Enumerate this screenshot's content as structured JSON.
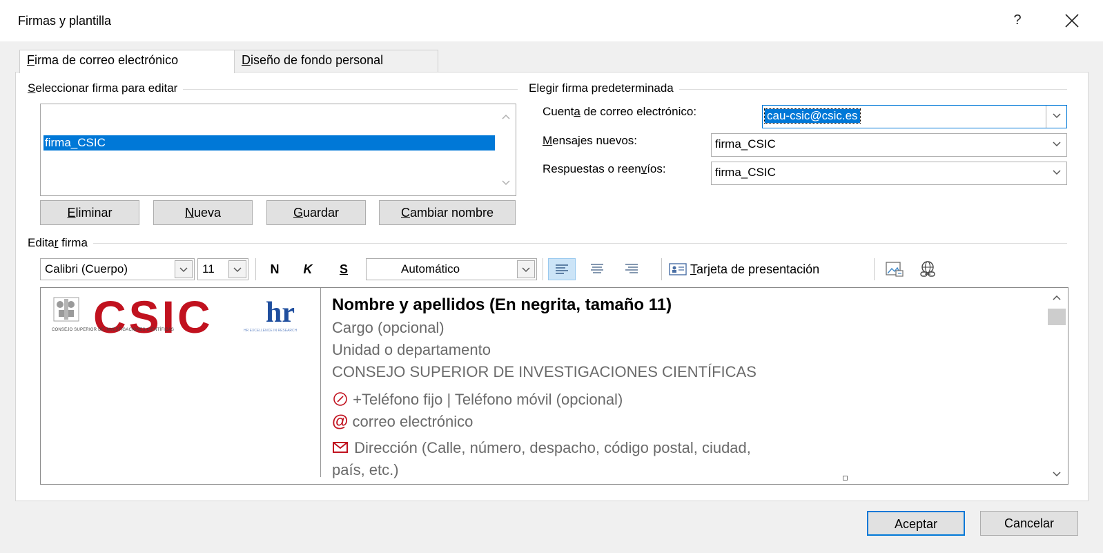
{
  "window": {
    "title": "Firmas y plantilla",
    "help": "?"
  },
  "tabs": [
    {
      "label": "Firma de correo electrónico",
      "accel": "F",
      "rest": "irma de correo electrónico"
    },
    {
      "label": "Diseño de fondo personal",
      "accel": "D",
      "rest": "iseño de fondo personal"
    }
  ],
  "select_sig": {
    "title_accel": "S",
    "title_rest": "eleccionar firma para editar",
    "items": [
      "firma_CSIC"
    ],
    "buttons": {
      "delete": {
        "accel": "E",
        "rest": "liminar"
      },
      "new": {
        "accel": "N",
        "rest": "ueva"
      },
      "save": {
        "accel": "G",
        "rest": "uardar"
      },
      "rename": {
        "accel": "C",
        "rest": "ambiar nombre"
      }
    }
  },
  "default_sig": {
    "title": "Elegir firma predeterminada",
    "account_label_a": "Cuent",
    "account_label_accel": "a",
    "account_label_b": " de correo electrónico:",
    "account_value": "cau-csic@csic.es",
    "new_label_accel": "M",
    "new_label_rest": "ensajes nuevos:",
    "new_value": "firma_CSIC",
    "reply_label_a": "Respuestas o reen",
    "reply_label_accel": "v",
    "reply_label_b": "íos:",
    "reply_value": "firma_CSIC"
  },
  "edit": {
    "title_a": "Edita",
    "title_accel": "r",
    "title_b": " firma",
    "font": "Calibri (Cuerpo)",
    "size": "11",
    "bold": "N",
    "italic": "K",
    "underline": "S",
    "color": "Automático",
    "card_accel": "T",
    "card_rest": "arjeta de presentación"
  },
  "signature": {
    "logo_word": "CSIC",
    "logo_sub": "Consejo Superior de Investigaciones Científicas",
    "hr_word": "hr",
    "hr_sub": "HR EXCELLENCE IN RESEARCH",
    "name": "Nombre y apellidos (En negrita, tamaño 11)",
    "position": "Cargo (opcional)",
    "unit": "Unidad o departamento",
    "org": "CONSEJO SUPERIOR DE INVESTIGACIONES CIENTÍFICAS",
    "phone": "+Teléfono fijo | Teléfono móvil (opcional)",
    "email": "correo electrónico",
    "address_1": "Dirección (Calle, número, despacho, código postal, ciudad,",
    "address_2": "país, etc.)"
  },
  "footer": {
    "ok": "Aceptar",
    "cancel": "Cancelar"
  },
  "colors": {
    "selection": "#0078d7",
    "csic_red": "#c1121f",
    "hr_blue": "#1f4e9e"
  }
}
